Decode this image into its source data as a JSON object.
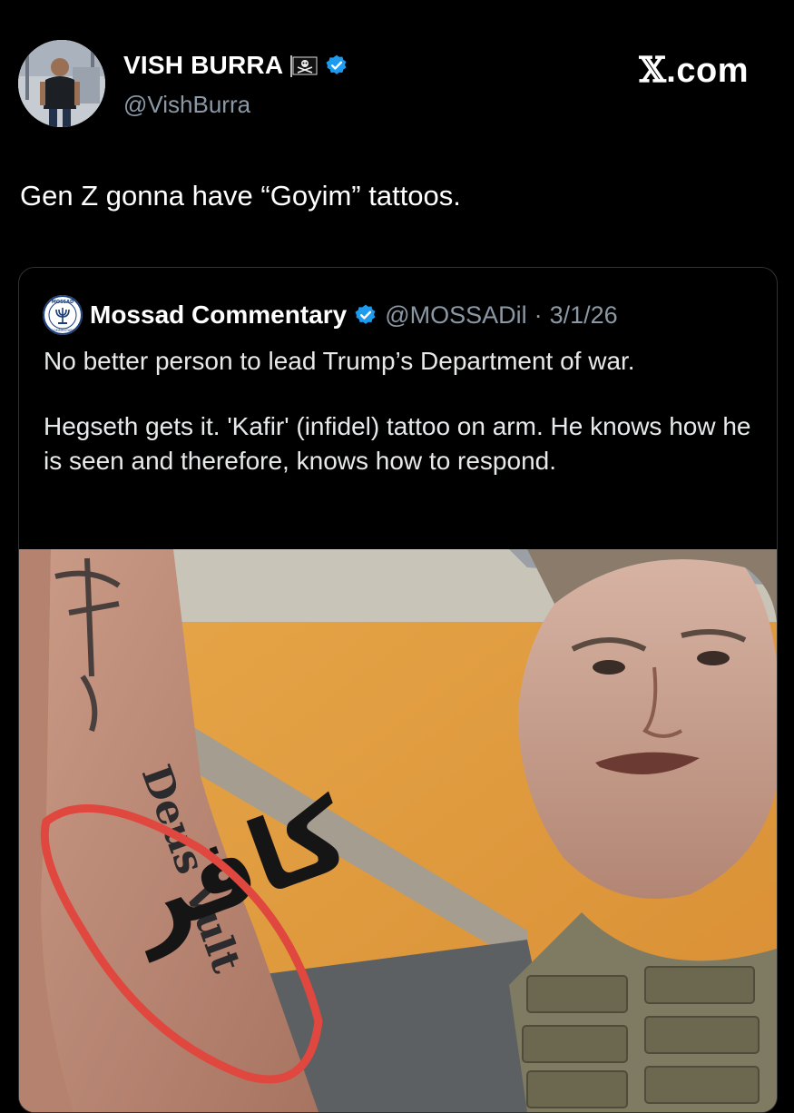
{
  "author": {
    "name": "VISH BURRA",
    "handle": "@VishBurra",
    "flag_icon": "pirate-flag-icon",
    "badge_icon": "verified-badge-icon"
  },
  "brand": {
    "text": "X.com",
    "glyph": "𝕏",
    "suffix": ".com"
  },
  "tweet": {
    "text": "Gen Z gonna have “Goyim” tattoos."
  },
  "quote": {
    "name": "Mossad Commentary",
    "handle": "@MOSSADil",
    "separator": "·",
    "date": "3/1/26",
    "avatar_text_top": "MOSSAD",
    "avatar_text_bottom": "COMMENTARY",
    "paragraph1": "No better person to lead Trump’s Department of war.",
    "paragraph2": "Hegseth gets it.  'Kafir' (infidel) tattoo on arm. He knows how he is seen and therefore, knows how to respond.",
    "image": {
      "tattoo_text": "Deus Vult",
      "tattoo_arabic": "كافر",
      "highlight_color": "#e0473e"
    }
  },
  "colors": {
    "background": "#000000",
    "text": "#e7e9ea",
    "muted": "#8b98a5",
    "verified": "#1d9bf0"
  }
}
